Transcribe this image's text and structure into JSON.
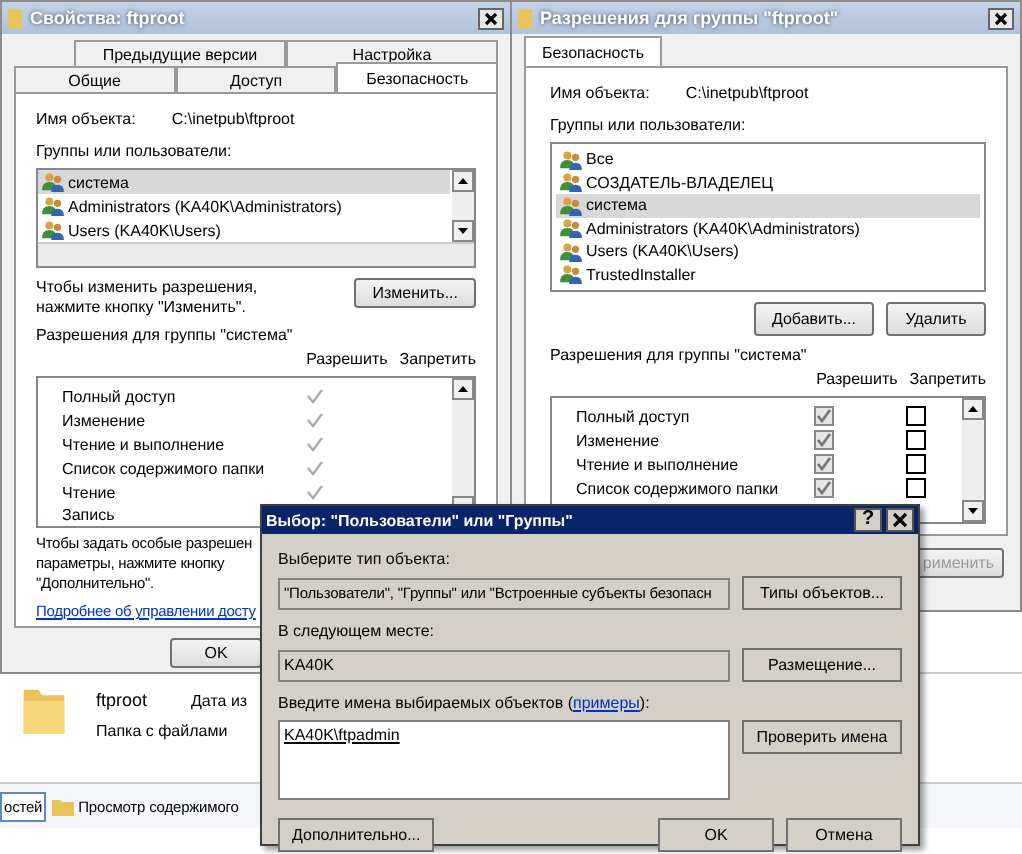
{
  "explorer": {
    "folder_name": "ftproot",
    "column_2": "Дата из",
    "folder_type": "Папка с файлами",
    "toolbar": [
      "остей",
      "Просмотр содержимого"
    ]
  },
  "properties_window": {
    "title": "Свойства: ftproot",
    "tab_rows": [
      [
        {
          "label": "Предыдущие версии",
          "selected": false
        },
        {
          "label": "Настройка",
          "selected": false
        }
      ],
      [
        {
          "label": "Общие",
          "selected": false
        },
        {
          "label": "Доступ",
          "selected": false
        },
        {
          "label": "Безопасность",
          "selected": true
        }
      ]
    ],
    "object_name_label": "Имя объекта:",
    "object_name": "C:\\inetpub\\ftproot",
    "groups_label": "Группы или пользователи:",
    "groups": [
      {
        "name": "система",
        "selected": true
      },
      {
        "name": "Administrators (KA40K\\Administrators)",
        "selected": false
      },
      {
        "name": "Users (KA40K\\Users)",
        "selected": false
      }
    ],
    "change_hint": [
      "Чтобы изменить разрешения,",
      "нажмите кнопку \"Изменить\"."
    ],
    "change_button": "Изменить...",
    "permissions_label": "Разрешения для группы \"система\"",
    "allow_header": "Разрешить",
    "deny_header": "Запретить",
    "permissions": [
      {
        "name": "Полный доступ",
        "allow": true
      },
      {
        "name": "Изменение",
        "allow": true
      },
      {
        "name": "Чтение и выполнение",
        "allow": true
      },
      {
        "name": "Список содержимого папки",
        "allow": true
      },
      {
        "name": "Чтение",
        "allow": true
      }
    ],
    "cut_row": "Запись",
    "advanced_hint": [
      "Чтобы задать особые разрешен",
      "параметры, нажмите кнопку",
      "\"Дополнительно\"."
    ],
    "help_link": "Подробнее об управлении досту",
    "ok_button": "OK"
  },
  "permissions_window": {
    "title": "Разрешения для группы \"ftproot\"",
    "tab": {
      "label": "Безопасность",
      "selected": true
    },
    "object_name_label": "Имя объекта:",
    "object_name": "C:\\inetpub\\ftproot",
    "groups_label": "Группы или пользователи:",
    "groups": [
      {
        "name": "Все",
        "selected": false
      },
      {
        "name": "СОЗДАТЕЛЬ-ВЛАДЕЛЕЦ",
        "selected": false
      },
      {
        "name": "система",
        "selected": true
      },
      {
        "name": "Administrators (KA40K\\Administrators)",
        "selected": false
      },
      {
        "name": "Users (KA40K\\Users)",
        "selected": false
      },
      {
        "name": "TrustedInstaller",
        "selected": false
      }
    ],
    "buttons": [
      "Добавить...",
      "Удалить"
    ],
    "permissions_label": "Разрешения для группы \"система\"",
    "allow_header": "Разрешить",
    "deny_header": "Запретить",
    "permissions": [
      {
        "name": "Полный доступ",
        "allow": true,
        "deny": false
      },
      {
        "name": "Изменение",
        "allow": true,
        "deny": false
      },
      {
        "name": "Чтение и выполнение",
        "allow": true,
        "deny": false
      },
      {
        "name": "Список содержимого папки",
        "allow": true,
        "deny": false
      }
    ],
    "apply_button": "рименить"
  },
  "select_dialog": {
    "title": "Выбор: \"Пользователи\" или \"Группы\"",
    "help_button": "?",
    "type_label": "Выберите тип объекта:",
    "type_value": "\"Пользователи\", \"Группы\" или \"Встроенные субъекты безопасн",
    "type_button": "Типы объектов...",
    "location_label": "В следующем месте:",
    "location_value": "KA40K",
    "location_button": "Размещение...",
    "names_label": "Введите имена выбираемых объектов (",
    "examples_link": "примеры",
    "names_label_end": "):",
    "names_value": "KA40K\\ftpadmin",
    "check_button": "Проверить имена",
    "advanced_button": "Дополнительно...",
    "ok_button": "OK",
    "cancel_button": "Отмена"
  }
}
